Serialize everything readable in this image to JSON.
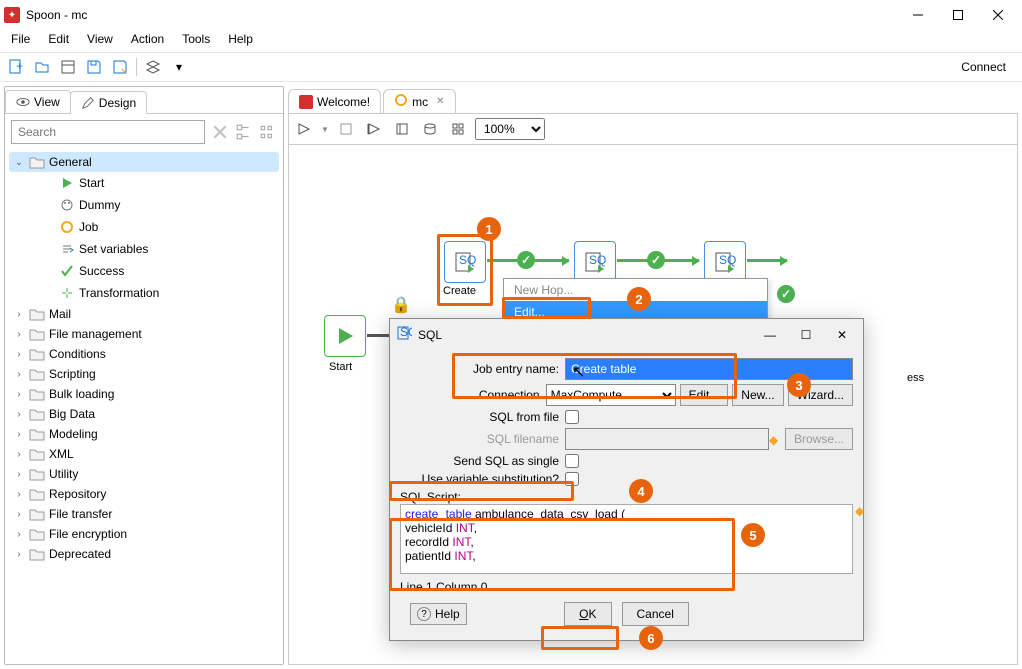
{
  "window": {
    "title": "Spoon - mc"
  },
  "menubar": [
    "File",
    "Edit",
    "View",
    "Action",
    "Tools",
    "Help"
  ],
  "toolbar": {
    "connect": "Connect"
  },
  "left": {
    "tabs": {
      "view": "View",
      "design": "Design"
    },
    "search_placeholder": "Search",
    "tree": {
      "general": "General",
      "start": "Start",
      "dummy": "Dummy",
      "job": "Job",
      "setvars": "Set variables",
      "success": "Success",
      "transformation": "Transformation",
      "mail": "Mail",
      "filemgmt": "File management",
      "conditions": "Conditions",
      "scripting": "Scripting",
      "bulk": "Bulk loading",
      "bigdata": "Big Data",
      "modeling": "Modeling",
      "xml": "XML",
      "utility": "Utility",
      "repository": "Repository",
      "filetransfer": "File transfer",
      "fileenc": "File encryption",
      "deprecated": "Deprecated"
    }
  },
  "editor": {
    "tabs": {
      "welcome": "Welcome!",
      "mc": "mc"
    },
    "zoom": "100%"
  },
  "canvas": {
    "start": "Start",
    "create": "Create",
    "ess": "ess"
  },
  "ctx": {
    "newhop": "New Hop...",
    "edit": "Edit..."
  },
  "dialog": {
    "title": "SQL",
    "job_entry_label": "Job entry name:",
    "job_entry_value": "Create table",
    "connection_label": "Connection",
    "connection_value": "MaxCompute",
    "edit_btn": "Edit...",
    "new_btn": "New...",
    "wizard_btn": "Wizard...",
    "sql_from_file": "SQL from file",
    "sql_filename": "SQL filename",
    "browse_btn": "Browse...",
    "send_single": "Send SQL as single",
    "use_var": "Use variable substitution?",
    "sql_script_label": "SQL Script:",
    "sql_lines": {
      "l1a": "create",
      "l1b": "table",
      "l1c": " ambulance_data_csv_load (",
      "l2a": "vehicleId ",
      "l2b": "INT",
      "l2c": ",",
      "l3a": "recordId ",
      "l3b": "INT",
      "l3c": ",",
      "l4a": "patientId ",
      "l4b": "INT",
      "l4c": ","
    },
    "status": "Line 1 Column 0",
    "help": "Help",
    "ok": "OK",
    "cancel": "Cancel"
  },
  "annotations": [
    "1",
    "2",
    "3",
    "4",
    "5",
    "6"
  ]
}
